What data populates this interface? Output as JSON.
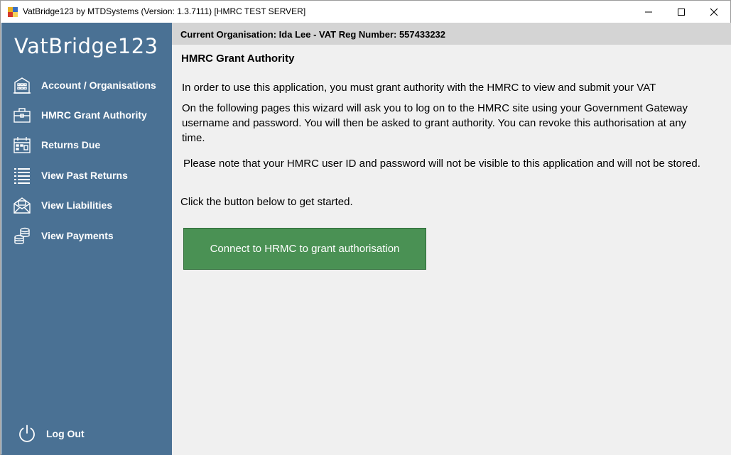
{
  "window": {
    "title": "VatBridge123 by MTDSystems (Version: 1.3.7111) [HMRC TEST SERVER]"
  },
  "sidebar": {
    "logo": "VatBridge123",
    "items": [
      {
        "label": "Account / Organisations",
        "icon": "building-icon"
      },
      {
        "label": "HMRC Grant Authority",
        "icon": "briefcase-icon"
      },
      {
        "label": "Returns Due",
        "icon": "calendar-icon"
      },
      {
        "label": "View Past Returns",
        "icon": "list-icon"
      },
      {
        "label": "View Liabilities",
        "icon": "envelope-icon"
      },
      {
        "label": "View Payments",
        "icon": "coins-icon"
      }
    ],
    "logout_label": "Log Out"
  },
  "main": {
    "org_bar": "Current Organisation: Ida Lee - VAT Reg Number: 557433232",
    "heading": "HMRC Grant Authority",
    "paragraphs": [
      "In order to use this application, you must grant authority with the HMRC to view and submit your VAT",
      "On the following pages this wizard will ask you to log on to the HMRC site using your Government Gateway username and password.  You will then be asked to grant authority.  You can revoke this authorisation at any time.",
      "Please note that your HMRC user ID and password will not be visible to this application and will not be stored.",
      "Click the button below to get started."
    ],
    "connect_button": "Connect to HRMC to grant authorisation"
  },
  "colors": {
    "sidebar": "#4a7194",
    "org_bar": "#d4d4d4",
    "content_bg": "#f0f0f0",
    "button": "#4a9154"
  }
}
